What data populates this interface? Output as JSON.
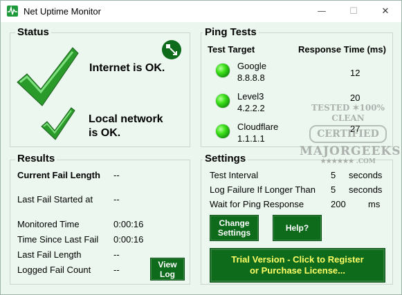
{
  "window": {
    "title": "Net Uptime Monitor",
    "minimize": "—",
    "maximize": "☐",
    "close": "✕"
  },
  "status": {
    "title": "Status",
    "internet_text": "Internet is OK.",
    "local_text": "Local network is OK."
  },
  "ping": {
    "title": "Ping Tests",
    "col_target": "Test Target",
    "col_response": "Response Time (ms)",
    "rows": [
      {
        "name": "Google",
        "ip": "8.8.8.8",
        "ms": "12"
      },
      {
        "name": "Level3",
        "ip": "4.2.2.2",
        "ms": "20"
      },
      {
        "name": "Cloudflare",
        "ip": "1.1.1.1",
        "ms": "27"
      }
    ]
  },
  "results": {
    "title": "Results",
    "current_fail_length_label": "Current Fail Length",
    "current_fail_length_value": "--",
    "last_fail_started_label": "Last Fail Started at",
    "last_fail_started_value": "--",
    "monitored_time_label": "Monitored Time",
    "monitored_time_value": "0:00:16",
    "time_since_last_fail_label": "Time Since Last Fail",
    "time_since_last_fail_value": "0:00:16",
    "last_fail_length_label": "Last Fail Length",
    "last_fail_length_value": "--",
    "logged_fail_count_label": "Logged Fail Count",
    "logged_fail_count_value": "--",
    "view_log_line1": "View",
    "view_log_line2": "Log"
  },
  "settings": {
    "title": "Settings",
    "test_interval_label": "Test Interval",
    "test_interval_value": "5",
    "test_interval_unit": "seconds",
    "log_failure_label": "Log Failure If Longer Than",
    "log_failure_value": "5",
    "log_failure_unit": "seconds",
    "wait_ping_label": "Wait for Ping Response",
    "wait_ping_value": "200",
    "wait_ping_unit": "ms",
    "change_settings_line1": "Change",
    "change_settings_line2": "Settings",
    "help_label": "Help?",
    "trial_line1": "Trial Version - Click to Register",
    "trial_line2": "or Purchase License..."
  },
  "watermark": {
    "line1": "TESTED ✶100% CLEAN",
    "line2": "CERTIFIED",
    "line3": "MAJORGEEKS",
    "line4": "★★★★★★ .COM"
  },
  "colors": {
    "accent_green": "#0e6b1c",
    "trial_text": "#ffff66",
    "background": "#ebf7ef"
  }
}
